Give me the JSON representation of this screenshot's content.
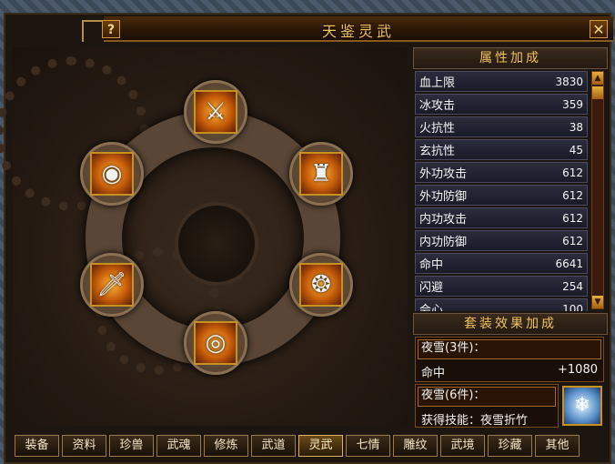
{
  "window": {
    "title": "天鉴灵武",
    "help_label": "?",
    "close_label": "✕"
  },
  "slots": [
    {
      "name": "spear",
      "glyph": "⚔"
    },
    {
      "name": "ring-amulet",
      "glyph": "◉"
    },
    {
      "name": "armor",
      "glyph": "♜"
    },
    {
      "name": "dagger",
      "glyph": "🗡"
    },
    {
      "name": "necklace",
      "glyph": "❂"
    },
    {
      "name": "belt",
      "glyph": "◎"
    }
  ],
  "attributes": {
    "header": "属性加成",
    "rows": [
      {
        "label": "血上限",
        "value": "3830"
      },
      {
        "label": "冰攻击",
        "value": "359"
      },
      {
        "label": "火抗性",
        "value": "38"
      },
      {
        "label": "玄抗性",
        "value": "45"
      },
      {
        "label": "外功攻击",
        "value": "612"
      },
      {
        "label": "外功防御",
        "value": "612"
      },
      {
        "label": "内功攻击",
        "value": "612"
      },
      {
        "label": "内功防御",
        "value": "612"
      },
      {
        "label": "命中",
        "value": "6641"
      },
      {
        "label": "闪避",
        "value": "254"
      },
      {
        "label": "会心",
        "value": "100"
      }
    ],
    "scroll_up": "▲",
    "scroll_down": "▼"
  },
  "set_bonus": {
    "header": "套装效果加成",
    "set1_name": "夜雪(3件)：",
    "set1_stat_label": "命中",
    "set1_stat_value": "+1080",
    "set2_name": "夜雪(6件)：",
    "set2_skill": "获得技能：夜雪折竹"
  },
  "tabs": [
    "装备",
    "资料",
    "珍兽",
    "武魂",
    "修炼",
    "武道",
    "灵武",
    "七情",
    "雕纹",
    "武境",
    "珍藏",
    "其他"
  ],
  "active_tab": "灵武",
  "colors": {
    "accent": "#f0c25a",
    "frame": "#8a5a1c"
  }
}
